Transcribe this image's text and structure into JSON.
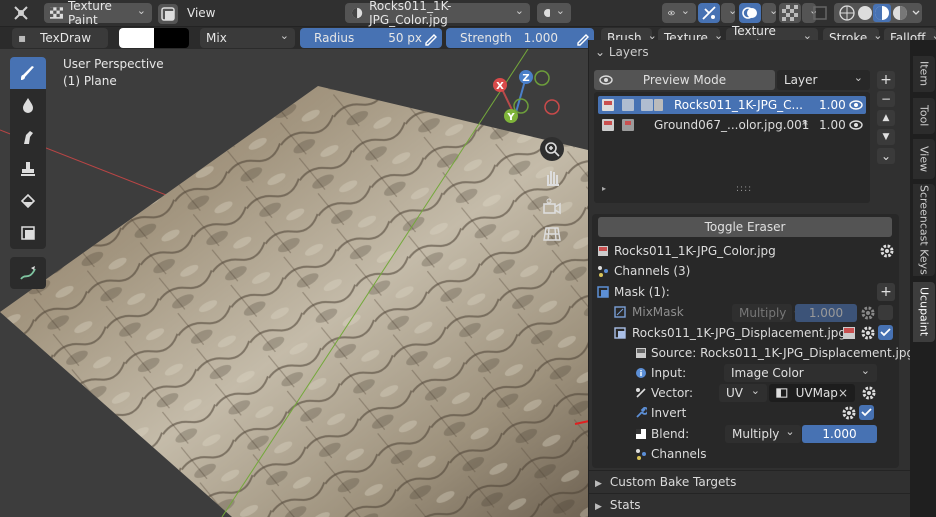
{
  "header": {
    "mode_label": "Texture Paint",
    "view_label": "View",
    "image_name": "Rocks011_1K-JPG_Color.jpg"
  },
  "toolbar": {
    "brush_name": "TexDraw",
    "blend_mode": "Mix",
    "radius_label": "Radius",
    "radius_value": "50 px",
    "strength_label": "Strength",
    "strength_value": "1.000",
    "menus": [
      "Brush",
      "Texture",
      "Texture Mask",
      "Stroke",
      "Falloff"
    ]
  },
  "viewport": {
    "view_name": "User Perspective",
    "object_name": "(1) Plane",
    "axes": {
      "x": "X",
      "y": "Y",
      "z": "Z"
    }
  },
  "panel": {
    "layers_title": "Layers",
    "preview_mode": "Preview Mode",
    "layer_dropdown": "Layer",
    "layers": [
      {
        "name": "Rocks011_1K-JPG_C...",
        "value": "1.00"
      },
      {
        "name": "Ground067_...olor.jpg.001",
        "marker": "*",
        "value": "1.00"
      }
    ],
    "handle": "::::",
    "toggle_eraser": "Toggle Eraser",
    "material_image": "Rocks011_1K-JPG_Color.jpg",
    "channels_count": "Channels (3)",
    "mask_title": "Mask (1):",
    "mixmask": {
      "label": "MixMask",
      "blend": "Multiply",
      "value": "1.000"
    },
    "mask_item": "Rocks011_1K-JPG_Displacement.jpg",
    "source": "Source: Rocks011_1K-JPG_Displacement.jpg",
    "input": {
      "label": "Input:",
      "value": "Image Color"
    },
    "vector": {
      "label": "Vector:",
      "type": "UV",
      "map": "UVMap"
    },
    "invert_label": "Invert",
    "blend": {
      "label": "Blend:",
      "mode": "Multiply",
      "value": "1.000"
    },
    "channels_label": "Channels",
    "custom_bake": "Custom Bake Targets",
    "stats": "Stats"
  },
  "tabs": [
    "Item",
    "Tool",
    "View",
    "Screencast Keys",
    "Ucupaint"
  ],
  "colors": {
    "accent": "#4772b3",
    "annotation_arrow": "#e02020"
  }
}
